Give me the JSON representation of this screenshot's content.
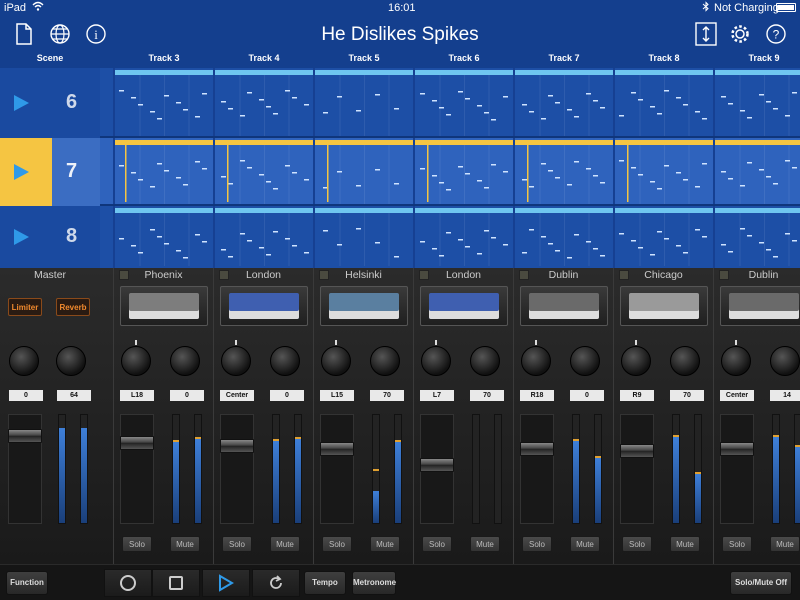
{
  "statusbar": {
    "device": "iPad",
    "time": "16:01",
    "battery": "Not Charging"
  },
  "header": {
    "title": "He Dislikes Spikes"
  },
  "tracks": {
    "scene_label": "Scene",
    "names": [
      "Track 3",
      "Track 4",
      "Track 5",
      "Track 6",
      "Track 7",
      "Track 8",
      "Track 9"
    ]
  },
  "scenes": [
    {
      "number": "6",
      "active": false
    },
    {
      "number": "7",
      "active": true
    },
    {
      "number": "8",
      "active": false
    }
  ],
  "mixer": {
    "master": {
      "name": "Master",
      "limiter_label": "Limiter",
      "reverb_label": "Reverb",
      "values": [
        "0",
        "64"
      ],
      "fader_level": 0.85
    },
    "channels": [
      {
        "name": "Phoenix",
        "pan": "L18",
        "send": "0",
        "fader_level": 0.78,
        "meters": [
          0.75,
          0.78
        ],
        "peaks": [
          0.75,
          0.78
        ]
      },
      {
        "name": "London",
        "pan": "Center",
        "send": "0",
        "fader_level": 0.75,
        "meters": [
          0.76,
          0.78
        ],
        "peaks": [
          0.76,
          0.78
        ]
      },
      {
        "name": "Helsinki",
        "pan": "L15",
        "send": "70",
        "fader_level": 0.72,
        "meters": [
          0.3,
          0.75
        ],
        "peaks": [
          0.48,
          0.75
        ]
      },
      {
        "name": "London",
        "pan": "L7",
        "send": "70",
        "fader_level": 0.55,
        "meters": [
          0.0,
          0.0
        ],
        "peaks": [
          0.0,
          0.0
        ]
      },
      {
        "name": "Dublin",
        "pan": "R18",
        "send": "0",
        "fader_level": 0.72,
        "meters": [
          0.76,
          0.6
        ],
        "peaks": [
          0.76,
          0.6
        ]
      },
      {
        "name": "Chicago",
        "pan": "R9",
        "send": "70",
        "fader_level": 0.7,
        "meters": [
          0.8,
          0.45
        ],
        "peaks": [
          0.8,
          0.45
        ]
      },
      {
        "name": "Dublin",
        "pan": "Center",
        "send": "14",
        "fader_level": 0.72,
        "meters": [
          0.8,
          0.7
        ],
        "peaks": [
          0.8,
          0.7
        ]
      }
    ],
    "solo_label": "Solo",
    "mute_label": "Mute"
  },
  "bottombar": {
    "function_label": "Function",
    "tempo_label": "Tempo",
    "metronome_label": "Metronome",
    "solo_mute_off_label": "Solo/Mute Off"
  },
  "colors": {
    "accent_yellow": "#f5c542",
    "header_blue": "#143f8e",
    "scene_blue": "#1d4fa6",
    "play_blue": "#2f9ae8",
    "orange": "#f28a2e"
  }
}
